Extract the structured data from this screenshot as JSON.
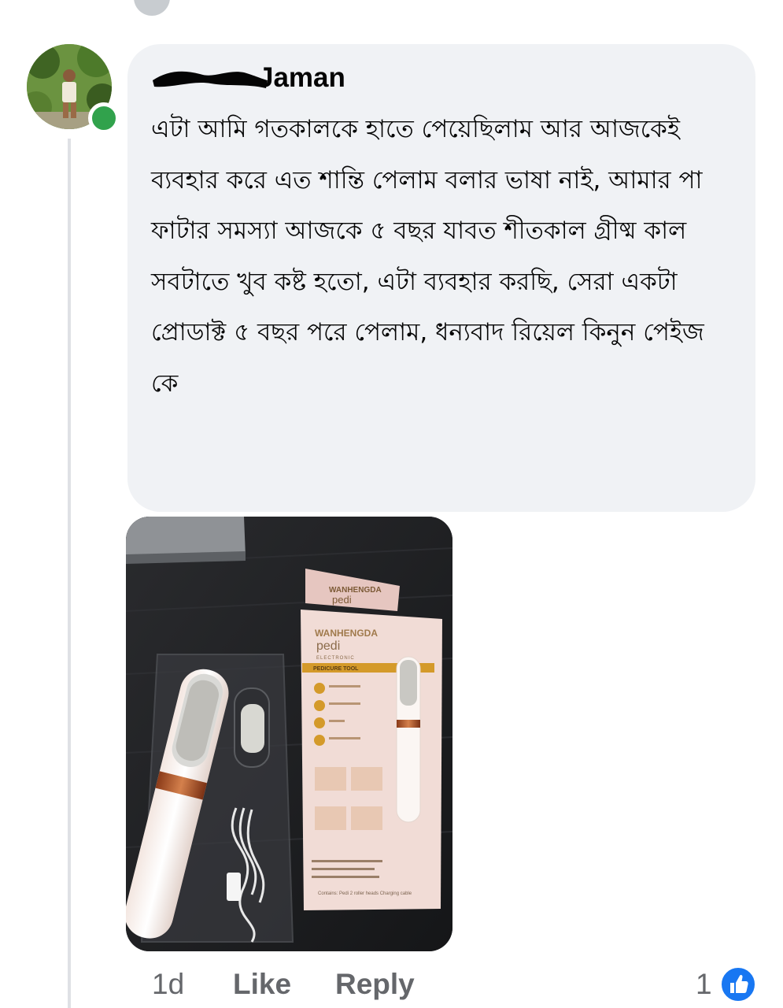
{
  "comment": {
    "author": "Jaman",
    "text": "এটা  আমি গতকালকে হাতে পেয়েছিলাম আর আজকেই ব্যবহার করে এত শান্তি পেলাম বলার ভাষা নাই,  আমার পা ফাটার সমস্যা আজকে ৫ বছর যাবত শীতকাল গ্রীষ্ম কাল সবটাতে খুব কষ্ট হতো, এটা ব্যবহার করছি, সেরা একটা প্রোডাক্ট ৫ বছর পরে পেলাম, ধন্যবাদ রিয়েল কিনুন পেইজ কে",
    "online": true
  },
  "photo": {
    "box_brand": "WANHENGDA",
    "box_product": "pedi",
    "box_subtitle": "ELECTRONIC",
    "box_band": "PEDICURE TOOL",
    "box_footer": "Contains: Pedi   2 roller heads   Charging cable"
  },
  "actions": {
    "time": "1d",
    "like_label": "Like",
    "reply_label": "Reply"
  },
  "reactions": {
    "count": "1",
    "icon": "thumbs-up-icon",
    "color": "#1877f2"
  }
}
